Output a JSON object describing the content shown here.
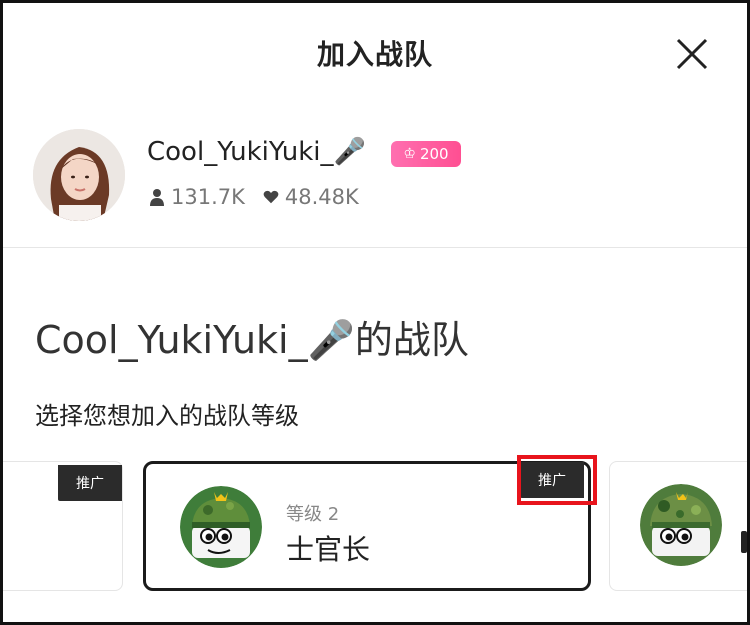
{
  "header": {
    "title": "加入战队",
    "close_icon": "close-icon"
  },
  "profile": {
    "name": "Cool_YukiYuki_🎤",
    "badge": {
      "icon": "crown-icon",
      "value": "200",
      "color": "#ff5a9e"
    },
    "followers": {
      "icon": "person-icon",
      "value": "131.7K"
    },
    "likes": {
      "icon": "heart-icon",
      "value": "48.48K"
    }
  },
  "team": {
    "title": "Cool_YukiYuki_🎤的战队",
    "subtitle": "选择您想加入的战队等级"
  },
  "cards": {
    "left": {
      "tag": "推广"
    },
    "center": {
      "tag": "推广",
      "level_label": "等级 2",
      "name": "士官长",
      "icon": "army-mascot-icon"
    },
    "right": {
      "icon": "army-mascot-icon"
    }
  },
  "colors": {
    "accent": "#ff5a9e",
    "highlight": "#e8141c",
    "tag_bg": "#2b2b2b"
  }
}
